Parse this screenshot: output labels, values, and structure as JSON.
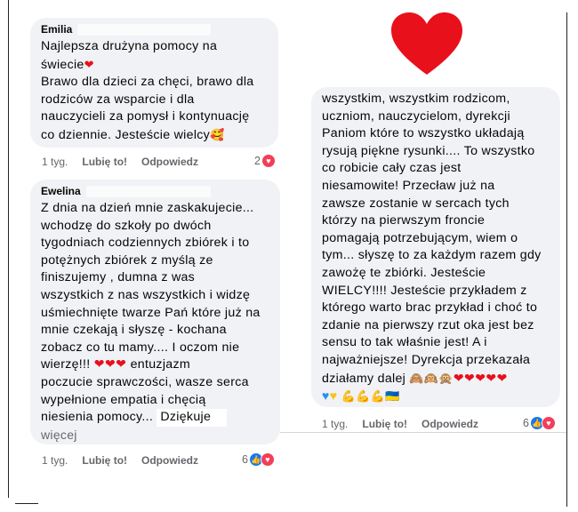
{
  "comment1": {
    "author": "Emilia",
    "lines": [
      "Najlepsza drużyna pomocy na",
      "świecie",
      "Brawo dla dzieci za chęci, brawo dla",
      "rodziców za wsparcie i dla",
      "nauczycieli za pomysł i kontynuację",
      "co dziennie. Jesteście wielcy"
    ],
    "time": "1 tyg.",
    "like_label": "Lubię to!",
    "reply_label": "Odpowiedz",
    "reaction_count": "2"
  },
  "comment2": {
    "author": "Ewelina",
    "lines": [
      "Z dnia na dzień mnie zaskakujecie...",
      "wchodzę do szkoły po dwóch",
      "tygodniach codziennych zbiórek i to",
      "potężnych zbiórek z myślą ze",
      "finiszujemy , dumna z was",
      "wszystkich z nas wszystkich i widzę",
      "uśmiechnięte twarze Pań które już na",
      "mnie czekają i słyszę - kochana",
      "zobacz co tu mamy.... I oczom nie",
      "wierzę!!!",
      "entuzjazm",
      "poczucie sprawczości, wasze serca",
      "wypełnione empatia i chęcią",
      "niesienia pomocy...",
      "Dziękuje"
    ],
    "more_label": "więcej",
    "time": "1 tyg.",
    "like_label": "Lubię to!",
    "reply_label": "Odpowiedz",
    "reaction_count": "6"
  },
  "comment3": {
    "lines": [
      "wszystkim, wszystkim rodzicom,",
      "uczniom, nauczycielom, dyrekcji",
      "Paniom które to wszystko układają",
      "rysują piękne rysunki.... To wszystko",
      "co robicie cały czas jest",
      "niesamowite! Przecław już na",
      "zawsze zostanie w sercach tych",
      "którzy na pierwszym froncie",
      "pomagają potrzebującym, wiem o",
      "tym... słyszę to za każdym razem gdy",
      "zawożę te zbiórki. Jesteście",
      "WIELCY!!!! Jesteście przykładem z",
      "którego warto brac przykład i choć to",
      "zdanie na pierwszy rzut oka jest bez",
      "sensu to tak właśnie jest! A i",
      "najważniejsze! Dyrekcja przekazała",
      "działamy dalej"
    ],
    "time": "1 tyg.",
    "like_label": "Lubię to!",
    "reply_label": "Odpowiedz",
    "reaction_count": "6"
  },
  "colors": {
    "bubble": "#f0f2f5",
    "love": "#f33e58",
    "like": "#1877f2",
    "big_heart": "#e8101b"
  },
  "icons": [
    "red-heart-emoji",
    "smiling-face-with-hearts-emoji",
    "see-no-evil-monkey-emoji",
    "flexed-biceps-emoji",
    "ukraine-flag-emoji",
    "blue-heart-emoji",
    "yellow-heart-emoji"
  ]
}
